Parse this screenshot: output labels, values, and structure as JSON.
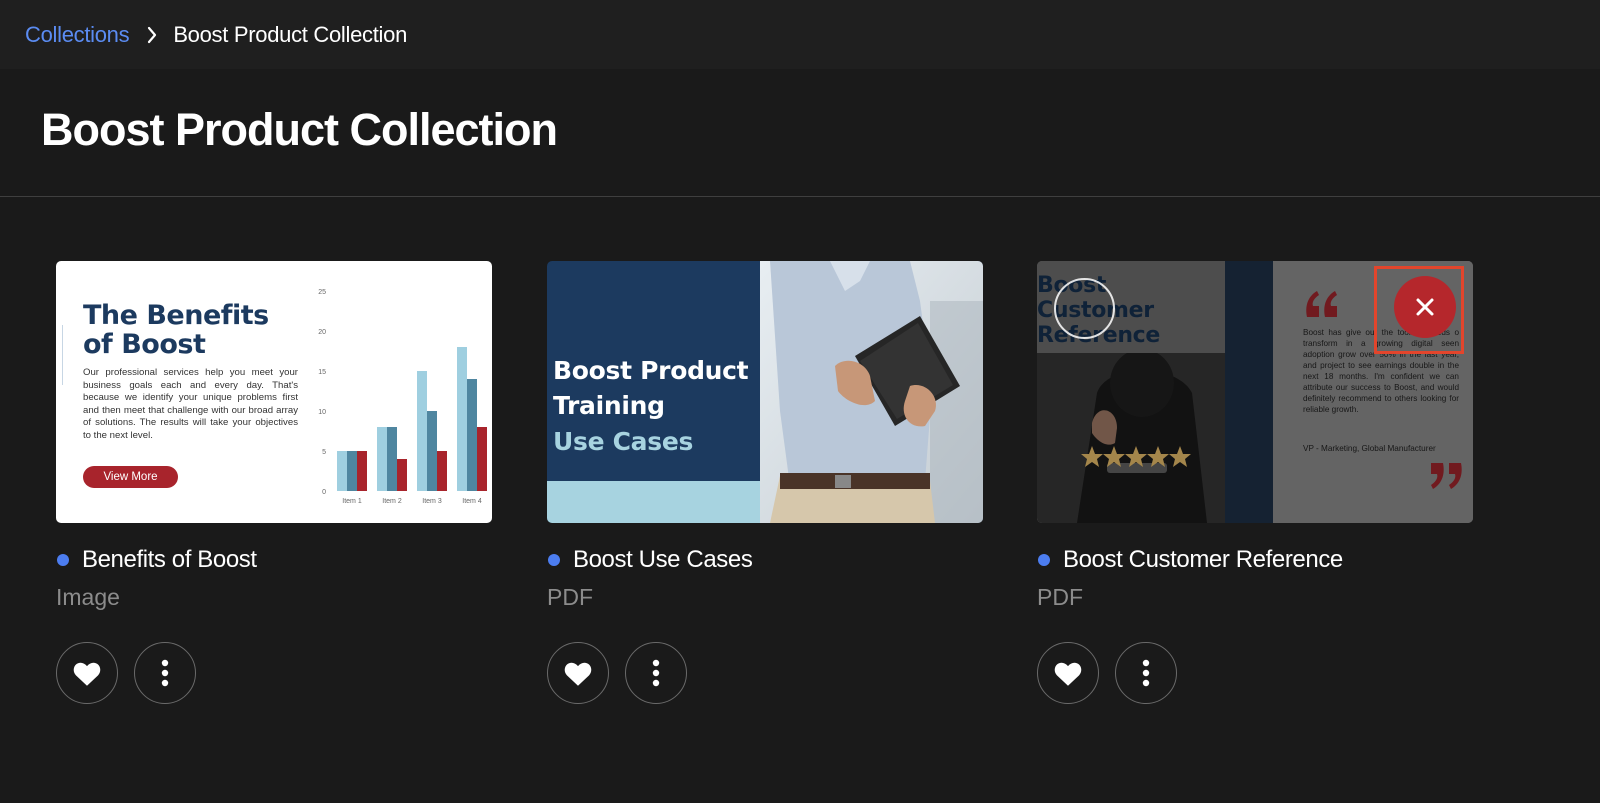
{
  "breadcrumb": {
    "parent": "Collections",
    "current": "Boost Product Collection"
  },
  "page": {
    "title": "Boost Product Collection"
  },
  "cards": [
    {
      "title": "Benefits of Boost",
      "type": "Image",
      "thumb": {
        "heading_line1": "The Benefits",
        "heading_line2": "of Boost",
        "body": "Our professional services help you meet your business goals each and every day. That's because we identify your unique problems first and then meet that challenge with our broad array of solutions. The results will take your objectives to the next level.",
        "button": "View More",
        "chart_data": {
          "type": "bar",
          "categories": [
            "Item 1",
            "Item 2",
            "Item 3",
            "Item 4"
          ],
          "series": [
            {
              "values": [
                5,
                8,
                15,
                18
              ]
            },
            {
              "values": [
                5,
                8,
                10,
                14
              ]
            },
            {
              "values": [
                5,
                4,
                5,
                8
              ]
            }
          ],
          "yticks": [
            0,
            5,
            10,
            15,
            20,
            25
          ],
          "ylim": [
            0,
            25
          ],
          "colors": [
            "#9fcfe0",
            "#4f86a0",
            "#a8242c"
          ]
        }
      }
    },
    {
      "title": "Boost Use Cases",
      "type": "PDF",
      "thumb": {
        "line1": "Boost Product",
        "line2": "Training",
        "line3": "Use Cases"
      }
    },
    {
      "title": "Boost Customer Reference",
      "type": "PDF",
      "thumb": {
        "title_line1": "Boost",
        "title_line2": "Customer",
        "title_line3": "Reference",
        "quote": "Boost has give our the tools it needs o transform in a growing digital seen adoption grow over 50% in the last year, and project to see earnings double in the next 18 months. I'm confident we can attribute our success to Boost, and would definitely recommend to others looking for reliable growth.",
        "attribution": "VP - Marketing, Global Manufacturer"
      }
    }
  ],
  "colors": {
    "accent_blue": "#4c7df0",
    "remove_red": "#b5272c",
    "highlight_box": "#e2452c"
  }
}
